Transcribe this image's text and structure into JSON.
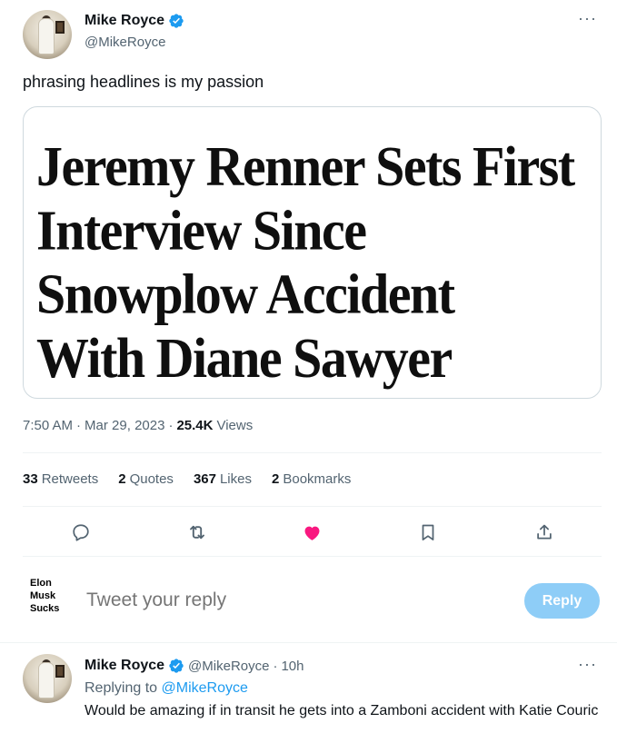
{
  "tweet": {
    "author": {
      "display_name": "Mike Royce",
      "handle": "@MikeRoyce",
      "verified_icon": "verified-badge-icon"
    },
    "more_label": "···",
    "text": "phrasing headlines is my passion",
    "media": {
      "headline_lines": [
        "Jeremy Renner Sets First",
        "Interview Since",
        "Snowplow Accident",
        "With Diane Sawyer"
      ]
    },
    "meta": {
      "time": "7:50 AM",
      "sep1": "·",
      "date": "Mar 29, 2023",
      "sep2": "·",
      "views_count": "25.4K",
      "views_label": "Views"
    },
    "stats": [
      {
        "num": "33",
        "label": "Retweets"
      },
      {
        "num": "2",
        "label": "Quotes"
      },
      {
        "num": "367",
        "label": "Likes"
      },
      {
        "num": "2",
        "label": "Bookmarks"
      }
    ],
    "actions": [
      "reply-icon",
      "retweet-icon",
      "like-icon",
      "bookmark-icon",
      "share-icon"
    ]
  },
  "reply_box": {
    "avatar_text_lines": [
      "Elon",
      "Musk",
      "Sucks"
    ],
    "placeholder": "Tweet your reply",
    "button_label": "Reply"
  },
  "reply_tweet": {
    "display_name": "Mike Royce",
    "handle": "@MikeRoyce",
    "sep": "·",
    "age": "10h",
    "more_label": "···",
    "replying_prefix": "Replying to",
    "replying_mention": "@MikeRoyce",
    "text": "Would be amazing if in transit he gets into a Zamboni accident with Katie Couric"
  },
  "colors": {
    "accent": "#1d9bf0",
    "like": "#f91880",
    "muted_text": "#536471",
    "reply_button_disabled": "#8ecdf7"
  }
}
